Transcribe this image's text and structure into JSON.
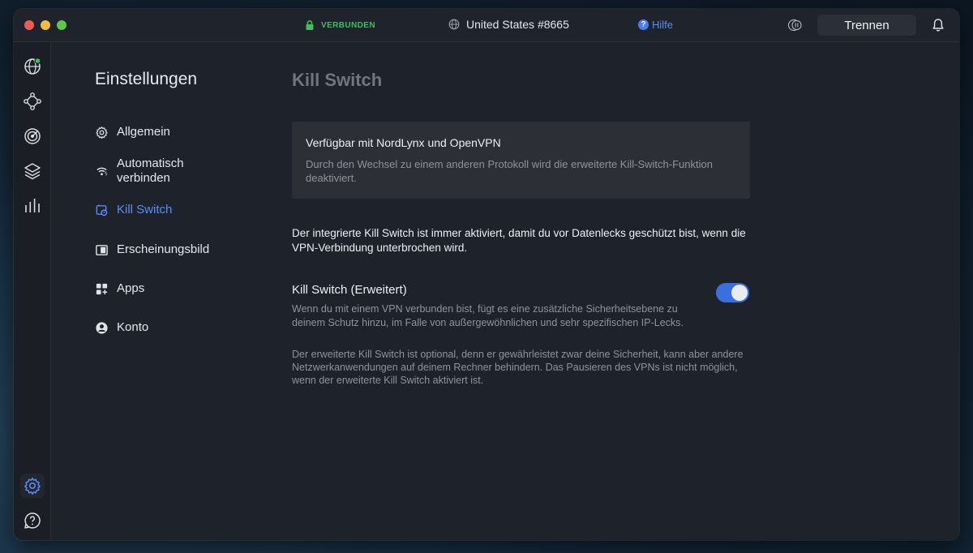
{
  "titlebar": {
    "status": "VERBUNDEN",
    "server": "United States #8665",
    "help": "Hilfe",
    "disconnect": "Trennen"
  },
  "sidebar": {
    "title": "Einstellungen",
    "items": [
      {
        "label": "Allgemein",
        "icon": "gear-icon"
      },
      {
        "label": "Automatisch\nverbinden",
        "icon": "auto-connect-icon"
      },
      {
        "label": "Kill Switch",
        "icon": "kill-switch-icon",
        "active": true
      },
      {
        "label": "Erscheinungsbild",
        "icon": "appearance-icon"
      },
      {
        "label": "Apps",
        "icon": "apps-icon"
      },
      {
        "label": "Konto",
        "icon": "account-icon"
      }
    ]
  },
  "rail": [
    "globe-icon",
    "meshnet-icon",
    "threat-protection-icon",
    "layers-icon",
    "stats-icon",
    "settings-icon",
    "support-icon"
  ],
  "main": {
    "title": "Kill Switch",
    "info_box": {
      "title": "Verfügbar mit NordLynx und OpenVPN",
      "text": "Durch den Wechsel zu einem anderen Protokoll wird die erweiterte Kill-Switch-Funktion deaktiviert."
    },
    "intro": "Der integrierte Kill Switch ist immer aktiviert, damit du vor Datenlecks geschützt bist, wenn die VPN-Verbindung unterbrochen wird.",
    "advanced": {
      "title": "Kill Switch (Erweitert)",
      "description": "Wenn du mit einem VPN verbunden bist, fügt es eine zusätzliche Sicherheitsebene zu deinem Schutz hinzu, im Falle von außergewöhnlichen und sehr spezifischen IP-Lecks.",
      "note": "Der erweiterte Kill Switch ist optional, denn er gewährleistet zwar deine Sicherheit, kann aber andere Netzwerkanwendungen auf deinem Rechner behindern. Das Pausieren des VPNs ist nicht möglich, wenn der erweiterte Kill Switch aktiviert ist.",
      "enabled": true
    }
  },
  "colors": {
    "accent": "#5b8cf7",
    "connected": "#3fbf5d",
    "toggle_on": "#3a6fe0"
  }
}
